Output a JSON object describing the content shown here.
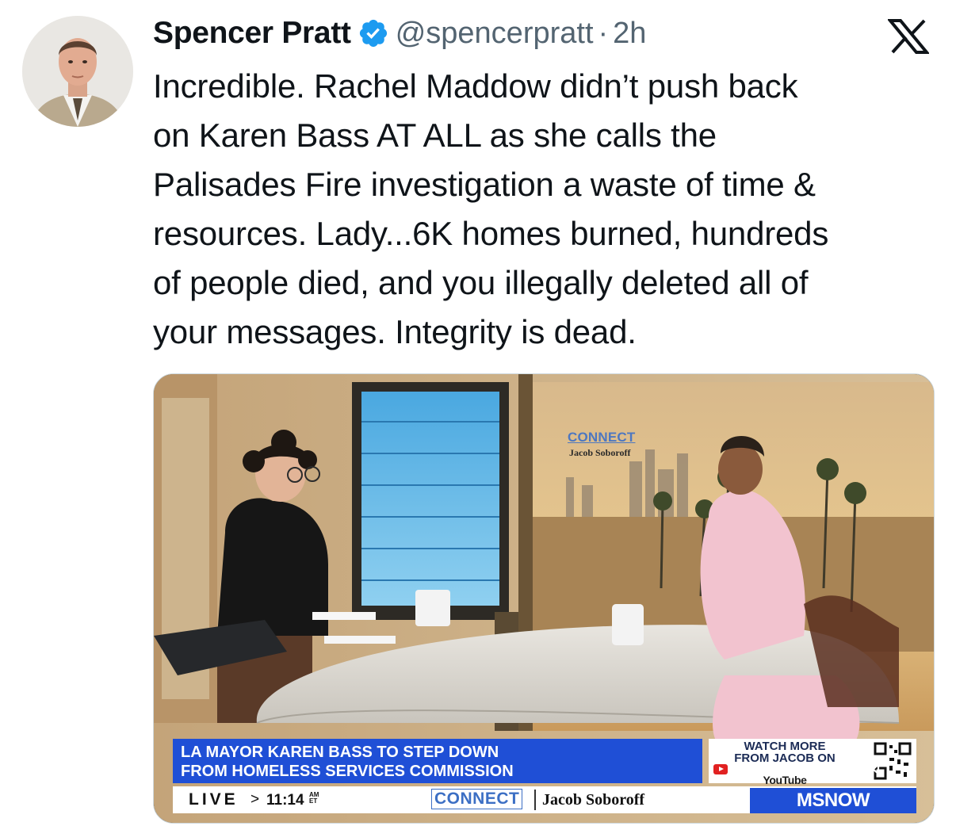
{
  "tweet": {
    "display_name": "Spencer Pratt",
    "handle": "@spencerpratt",
    "separator": "·",
    "time": "2h",
    "text_lines": [
      "Incredible. Rachel Maddow didn’t push back",
      "on Karen Bass AT ALL as she calls the",
      "Palisades Fire investigation a waste of time &",
      "resources. Lady...6K homes burned, hundreds",
      "of people died, and you illegally deleted all of",
      "your messages. Integrity is dead."
    ]
  },
  "icons": {
    "verified": "verified-badge-icon",
    "brand": "x-logo-icon",
    "mute": "mute-icon"
  },
  "colors": {
    "verified": "#1d9bf0",
    "secondary_text": "#536471",
    "chyron_blue": "#1f4fd6"
  },
  "video": {
    "headline_lines": [
      "LA MAYOR KAREN BASS TO STEP DOWN",
      "FROM HOMELESS SERVICES COMMISSION"
    ],
    "watch_lines": [
      "WATCH MORE",
      "FROM JACOB ON"
    ],
    "youtube": "YouTube",
    "live": "LIVE",
    "arrow": ">",
    "clock": "11:14",
    "clock_am": "AM",
    "clock_et": "ET",
    "show_name": "CONNECT",
    "show_host": "Jacob Soboroff",
    "network": "MSNOW",
    "set_show_name": "CONNECT",
    "set_show_host": "Jacob Soboroff"
  }
}
